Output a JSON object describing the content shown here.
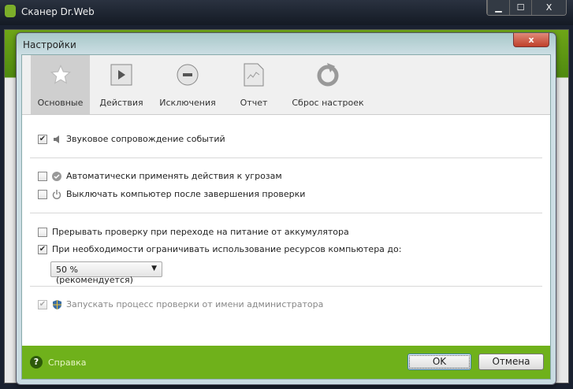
{
  "window": {
    "title": "Сканер Dr.Web",
    "buttons": {
      "minimize": "▁",
      "maximize": "☐",
      "close": "X"
    }
  },
  "dialog": {
    "title": "Настройки",
    "close": "x"
  },
  "tabs": [
    {
      "label": "Основные",
      "icon": "star-icon",
      "active": true
    },
    {
      "label": "Действия",
      "icon": "play-icon"
    },
    {
      "label": "Исключения",
      "icon": "minus-circle-icon"
    },
    {
      "label": "Отчет",
      "icon": "report-icon"
    },
    {
      "label": "Сброс настроек",
      "icon": "reset-icon"
    }
  ],
  "options": [
    {
      "label": "Звуковое сопровождение событий",
      "checked": true
    },
    {
      "label": "Автоматически применять действия к угрозам",
      "checked": false
    },
    {
      "label": "Выключать компьютер после завершения проверки",
      "checked": false
    },
    {
      "label": "Прерывать проверку при переходе на питание от аккумулятора",
      "checked": false
    },
    {
      "label": "При необходимости ограничивать использование ресурсов компьютера до:",
      "checked": true
    },
    {
      "label": "Запускать процесс проверки от имени администратора",
      "checked": true,
      "disabled": true
    }
  ],
  "resource_limit": {
    "value": "50 % (рекомендуется)"
  },
  "footer": {
    "help": "Справка",
    "ok": "OK",
    "cancel": "Отмена"
  },
  "colors": {
    "accent": "#6fb11b"
  }
}
